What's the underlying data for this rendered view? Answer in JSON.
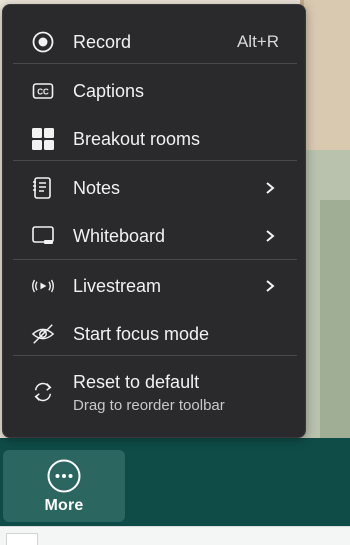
{
  "menu": {
    "items": [
      {
        "label": "Record",
        "shortcut": "Alt+R",
        "icon": "record-icon"
      },
      {
        "label": "Captions",
        "icon": "captions-icon"
      },
      {
        "label": "Breakout rooms",
        "icon": "breakout-rooms-icon"
      },
      {
        "label": "Notes",
        "icon": "notes-icon",
        "submenu": true
      },
      {
        "label": "Whiteboard",
        "icon": "whiteboard-icon",
        "submenu": true
      },
      {
        "label": "Livestream",
        "icon": "livestream-icon",
        "submenu": true
      },
      {
        "label": "Start focus mode",
        "icon": "focus-mode-icon"
      },
      {
        "label": "Reset to default",
        "sublabel": "Drag to reorder toolbar",
        "icon": "reset-icon"
      }
    ]
  },
  "toolbar": {
    "more_label": "More",
    "more_icon": "more-icon"
  },
  "colors": {
    "menu_bg": "#2a2a2c",
    "toolbar_bg": "#0f4c48",
    "more_btn_bg": "#2b6660"
  }
}
